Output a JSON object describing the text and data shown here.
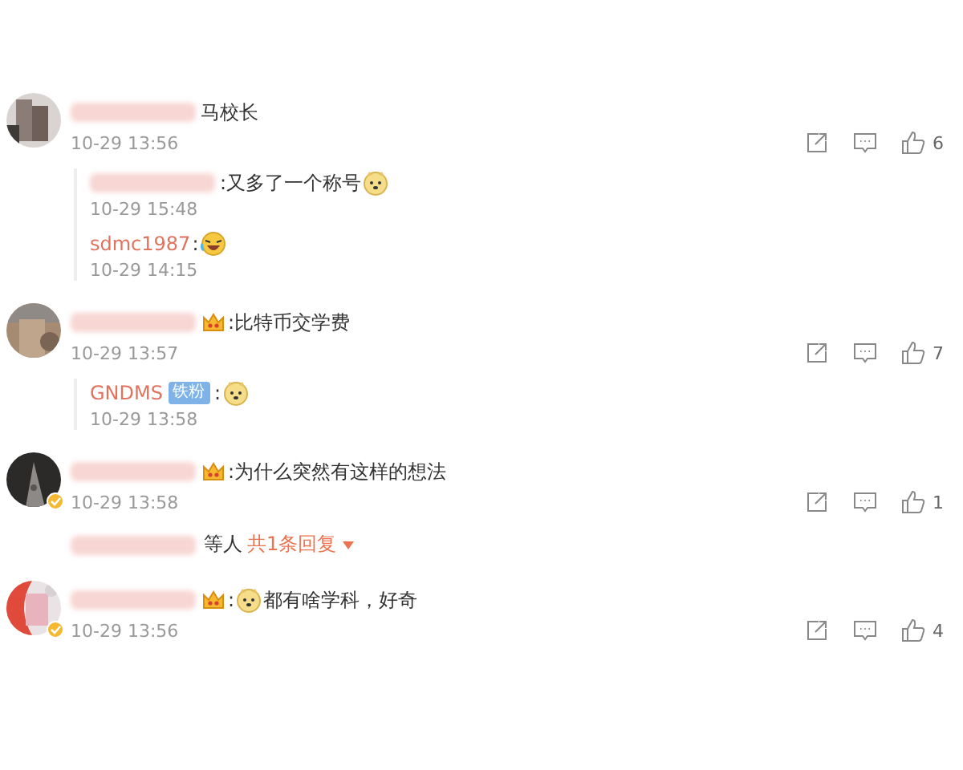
{
  "comments": [
    {
      "verified": false,
      "parts": [
        {
          "kind": "blurred"
        },
        {
          "kind": "text",
          "text": "马校长"
        }
      ],
      "time": "10-29 13:56",
      "likes": "6",
      "replies": [
        {
          "parts": [
            {
              "kind": "blurred"
            },
            {
              "kind": "text",
              "text": ":又多了一个称号"
            },
            {
              "kind": "dog"
            }
          ],
          "time": "10-29 15:48"
        },
        {
          "parts": [
            {
              "kind": "name",
              "text": "sdmc1987"
            },
            {
              "kind": "text",
              "text": ":"
            },
            {
              "kind": "laugh"
            }
          ],
          "time": "10-29 14:15"
        }
      ]
    },
    {
      "verified": false,
      "parts": [
        {
          "kind": "blurred"
        },
        {
          "kind": "crown"
        },
        {
          "kind": "text",
          "text": ":比特币交学费"
        }
      ],
      "time": "10-29 13:57",
      "likes": "7",
      "replies": [
        {
          "parts": [
            {
              "kind": "name",
              "text": "GNDMS"
            },
            {
              "kind": "tag",
              "text": "铁粉"
            },
            {
              "kind": "text",
              "text": ":"
            },
            {
              "kind": "dog"
            }
          ],
          "time": "10-29 13:58"
        }
      ]
    },
    {
      "verified": true,
      "parts": [
        {
          "kind": "blurred"
        },
        {
          "kind": "crown"
        },
        {
          "kind": "text",
          "text": ":为什么突然有这样的想法"
        }
      ],
      "time": "10-29 13:58",
      "likes": "1",
      "summary": {
        "text": "等人",
        "link": "共1条回复"
      }
    },
    {
      "verified": true,
      "parts": [
        {
          "kind": "blurred"
        },
        {
          "kind": "crown"
        },
        {
          "kind": "text",
          "text": ":"
        },
        {
          "kind": "dog"
        },
        {
          "kind": "text",
          "text": "都有啥学科，好奇"
        }
      ],
      "time": "10-29 13:56",
      "likes": "4"
    }
  ]
}
